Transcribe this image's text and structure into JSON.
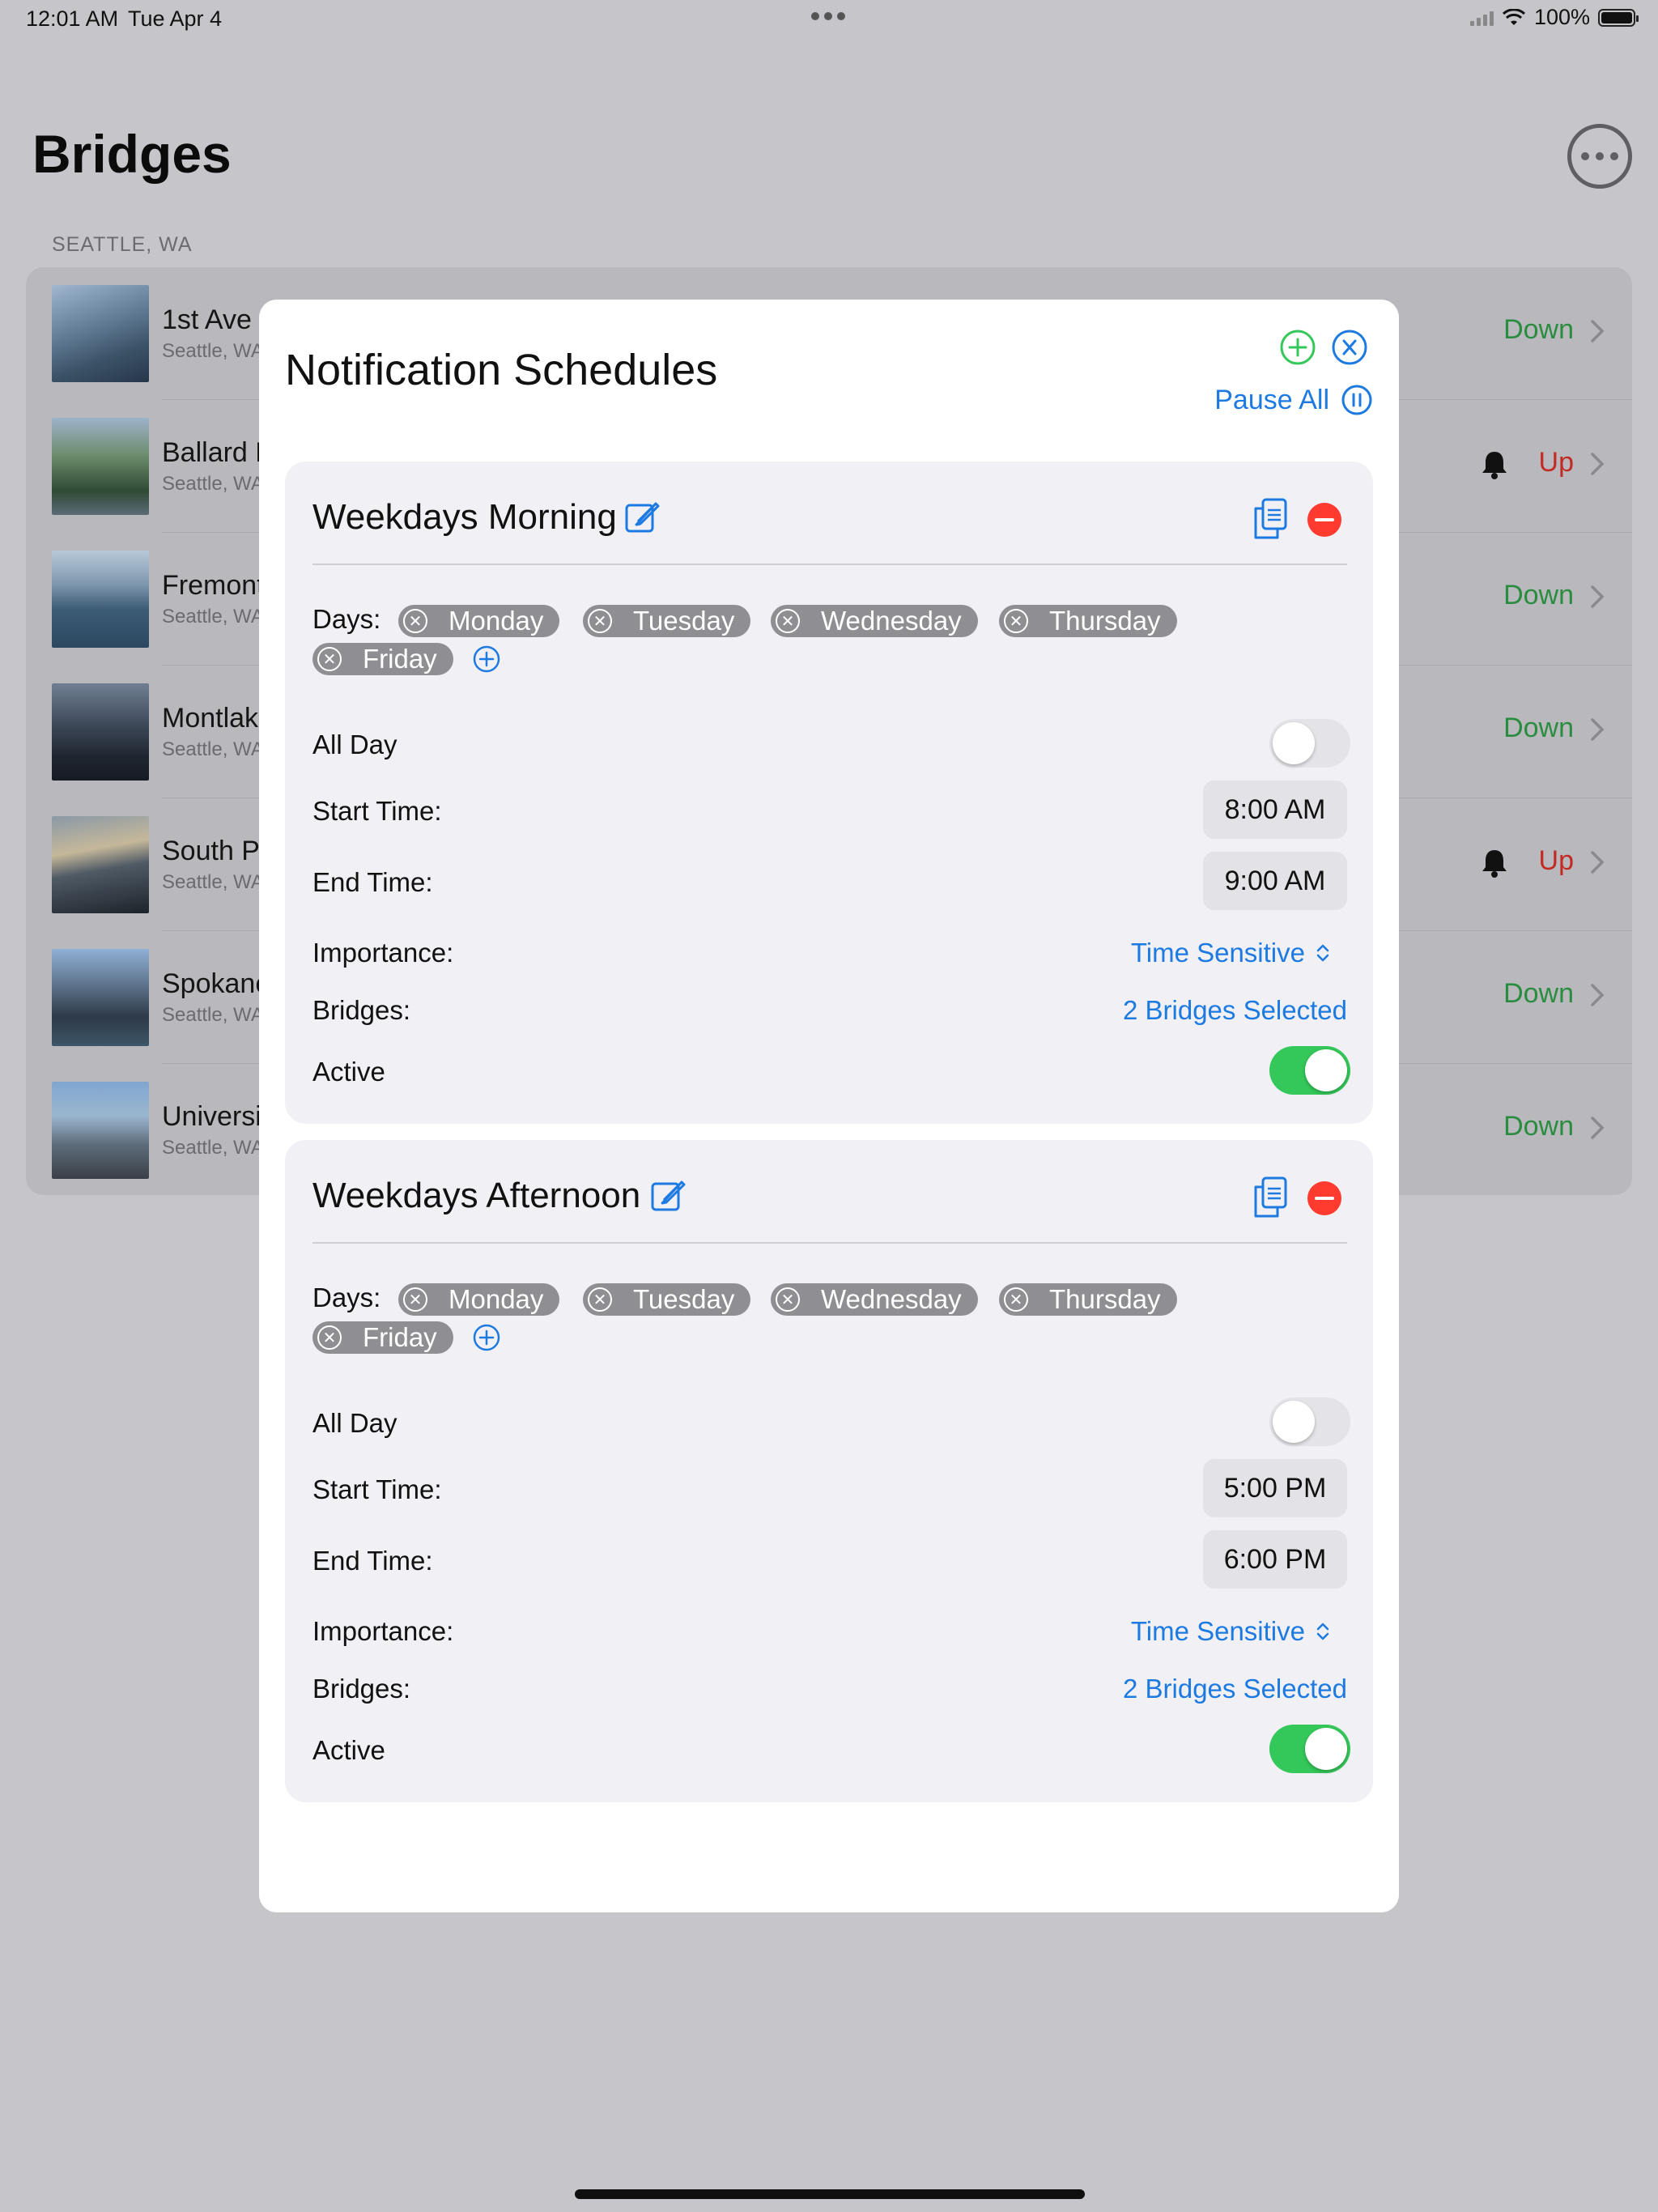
{
  "status_bar": {
    "time": "12:01 AM",
    "date": "Tue Apr 4",
    "battery": "100%"
  },
  "page": {
    "title": "Bridges",
    "section": "SEATTLE, WA"
  },
  "bridges": [
    {
      "name": "1st Ave S",
      "location": "Seattle, WA",
      "status": "Down",
      "notify": false
    },
    {
      "name": "Ballard B",
      "location": "Seattle, WA",
      "status": "Up",
      "notify": true
    },
    {
      "name": "Fremont",
      "location": "Seattle, WA",
      "status": "Down",
      "notify": false
    },
    {
      "name": "Montlak",
      "location": "Seattle, WA",
      "status": "Down",
      "notify": false
    },
    {
      "name": "South P",
      "location": "Seattle, WA",
      "status": "Up",
      "notify": true
    },
    {
      "name": "Spokane",
      "location": "Seattle, WA",
      "status": "Down",
      "notify": false
    },
    {
      "name": "Universi",
      "location": "Seattle, WA",
      "status": "Down",
      "notify": false
    }
  ],
  "modal": {
    "title": "Notification Schedules",
    "pause_all": "Pause All",
    "labels": {
      "days": "Days:",
      "all_day": "All Day",
      "start_time": "Start Time:",
      "end_time": "End Time:",
      "importance": "Importance:",
      "bridges": "Bridges:",
      "active": "Active"
    },
    "schedules": [
      {
        "name": "Weekdays Morning",
        "days": [
          "Monday",
          "Tuesday",
          "Wednesday",
          "Thursday",
          "Friday"
        ],
        "all_day": false,
        "start_time": "8:00 AM",
        "end_time": "9:00 AM",
        "importance": "Time Sensitive",
        "bridges": "2 Bridges Selected",
        "active": true
      },
      {
        "name": "Weekdays Afternoon",
        "days": [
          "Monday",
          "Tuesday",
          "Wednesday",
          "Thursday",
          "Friday"
        ],
        "all_day": false,
        "start_time": "5:00 PM",
        "end_time": "6:00 PM",
        "importance": "Time Sensitive",
        "bridges": "2 Bridges Selected",
        "active": true
      }
    ]
  },
  "colors": {
    "accent": "#1d7ae0",
    "down": "#2a8c3e",
    "up": "#c32a23",
    "toggle_on": "#34c759",
    "delete": "#ff3b30"
  }
}
